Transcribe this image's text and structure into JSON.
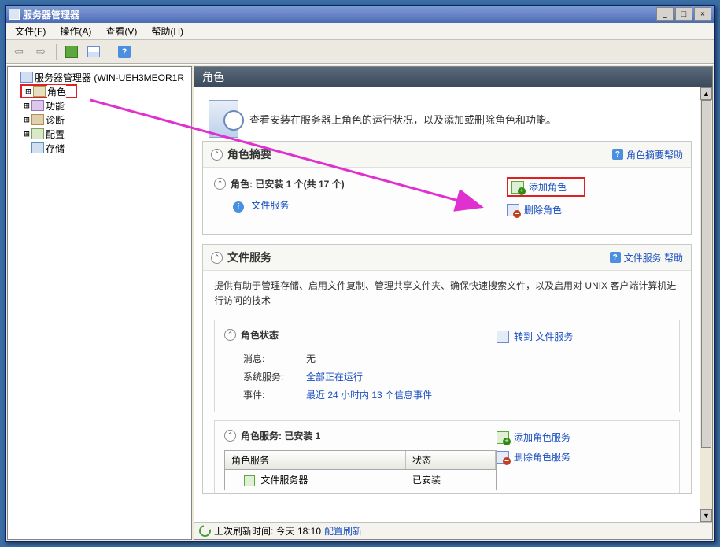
{
  "title": "服务器管理器",
  "menus": {
    "file": "文件(F)",
    "action": "操作(A)",
    "view": "查看(V)",
    "help": "帮助(H)"
  },
  "tree": {
    "root": "服务器管理器 (WIN-UEH3MEOR1R",
    "items": [
      "角色",
      "功能",
      "诊断",
      "配置",
      "存储"
    ]
  },
  "banner": "角色",
  "intro": "查看安装在服务器上角色的运行状况，以及添加或删除角色和功能。",
  "summary": {
    "title": "角色摘要",
    "help": "角色摘要帮助",
    "roles_title": "角色: 已安装 1 个(共 17 个)",
    "add": "添加角色",
    "remove": "删除角色",
    "service": "文件服务"
  },
  "file_services": {
    "title": "文件服务",
    "help": "文件服务 帮助",
    "desc": "提供有助于管理存储、启用文件复制、管理共享文件夹、确保快速搜索文件，以及启用对 UNIX 客户端计算机进行访问的技术",
    "status_title": "角色状态",
    "goto": "转到 文件服务",
    "msg_k": "消息:",
    "msg_v": "无",
    "svc_k": "系统服务:",
    "svc_v": "全部正在运行",
    "evt_k": "事件:",
    "evt_v": "最近 24 小时内 13 个信息事件",
    "roles_svc_title": "角色服务: 已安装 1",
    "add_svc": "添加角色服务",
    "remove_svc": "删除角色服务",
    "col1": "角色服务",
    "col2": "状态",
    "row1_name": "文件服务器",
    "row1_status": "已安装"
  },
  "status": {
    "label": "上次刷新时间: 今天 18:10",
    "link": "配置刷新"
  }
}
